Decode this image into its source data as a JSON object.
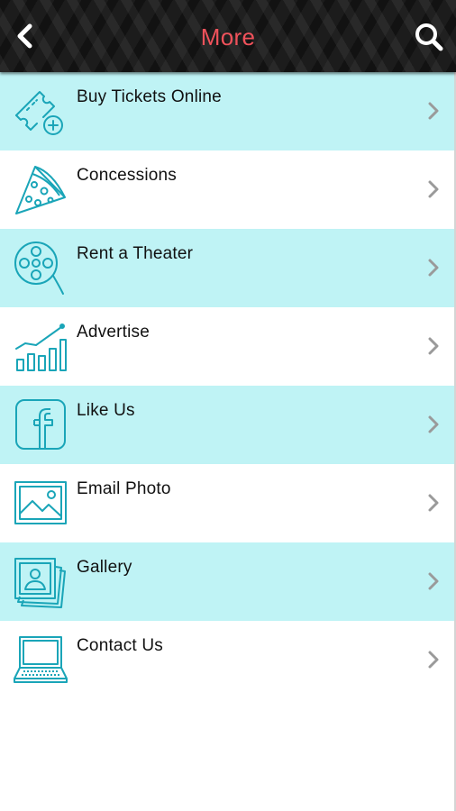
{
  "header": {
    "title": "More",
    "back_icon": "chevron-left-icon",
    "search_icon": "search-icon",
    "title_color": "#f0525b"
  },
  "menu": {
    "items": [
      {
        "label": "Buy Tickets Online",
        "icon": "ticket-add-icon"
      },
      {
        "label": "Concessions",
        "icon": "pizza-slice-icon"
      },
      {
        "label": "Rent a Theater",
        "icon": "film-reel-icon"
      },
      {
        "label": "Advertise",
        "icon": "bar-chart-icon"
      },
      {
        "label": "Like Us",
        "icon": "facebook-icon"
      },
      {
        "label": "Email Photo",
        "icon": "photo-icon"
      },
      {
        "label": "Gallery",
        "icon": "gallery-icon"
      },
      {
        "label": "Contact Us",
        "icon": "laptop-icon"
      }
    ]
  },
  "colors": {
    "row_alt": "#bff3f5",
    "icon_stroke": "#1aa5b8",
    "chevron": "#9a9a9a"
  }
}
